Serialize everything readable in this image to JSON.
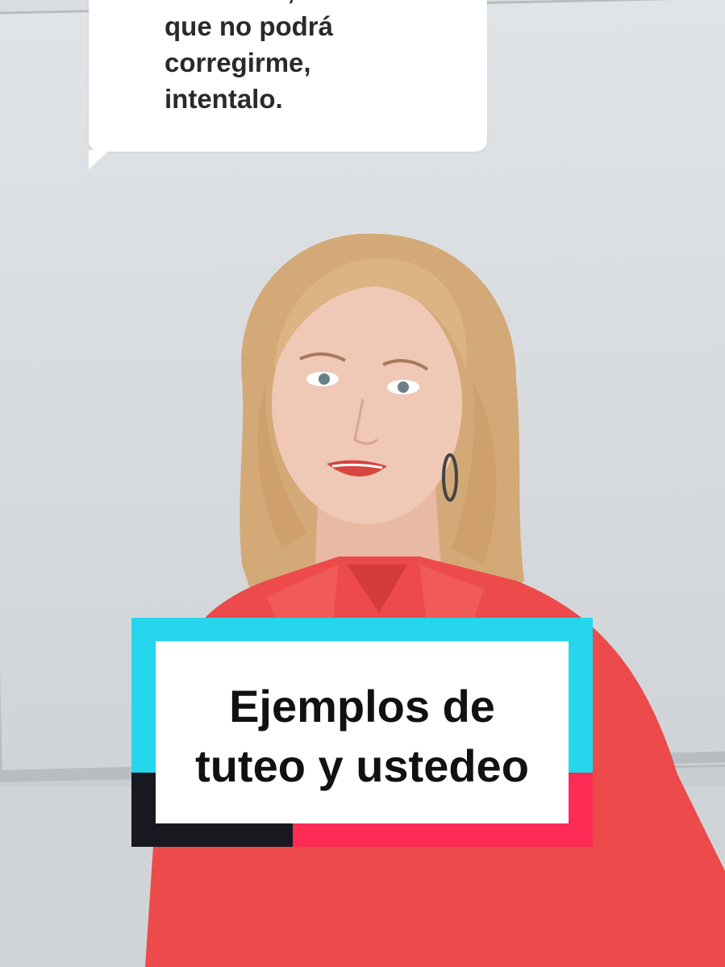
{
  "comment": {
    "lines": [
      "Literatura, creo",
      "que no podrá",
      "corregirme,",
      "intentalo."
    ]
  },
  "title": {
    "line1": "Ejemplos de",
    "line2": "tuteo y ustedeo"
  },
  "colors": {
    "cyan": "#25d6ec",
    "red": "#fe2b54",
    "black": "#181920",
    "shirt": "#ee4a4c",
    "hair": "#d6ad7c"
  }
}
